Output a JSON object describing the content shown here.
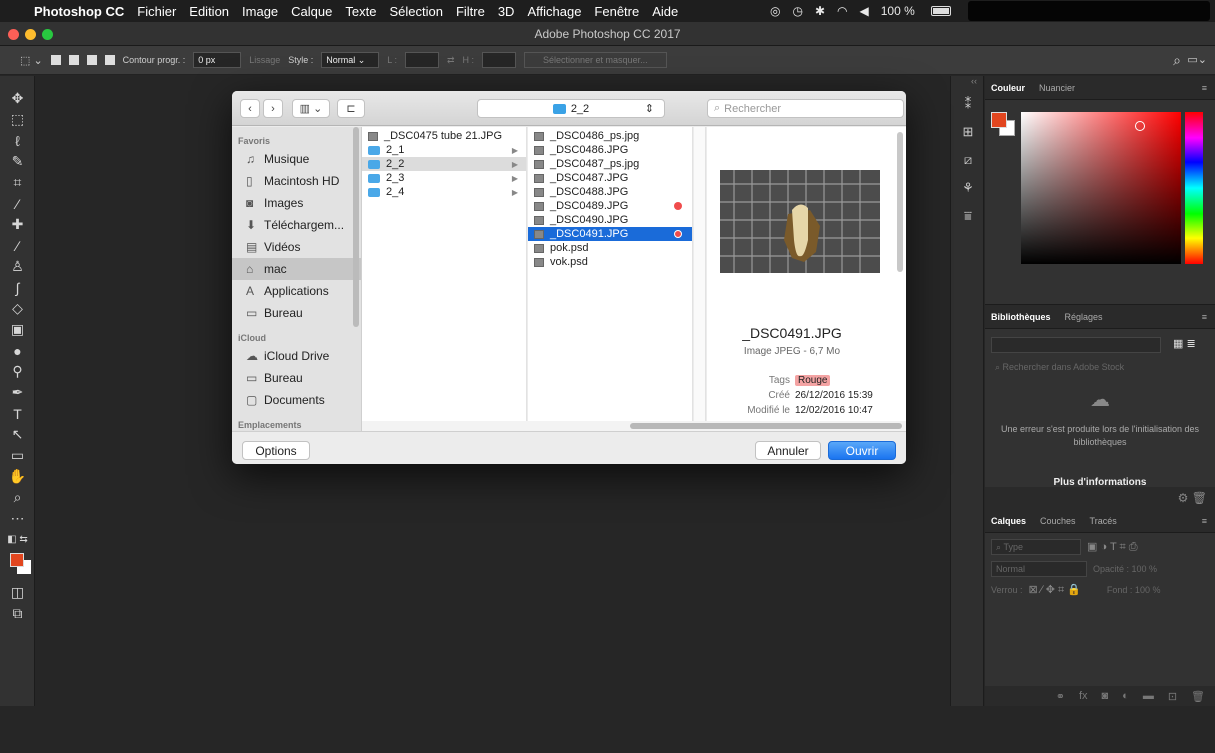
{
  "menubar": {
    "items": [
      "Photoshop CC",
      "Fichier",
      "Edition",
      "Image",
      "Calque",
      "Texte",
      "Sélection",
      "Filtre",
      "3D",
      "Affichage",
      "Fenêtre",
      "Aide"
    ],
    "battery": "100 %"
  },
  "window": {
    "title": "Adobe Photoshop CC 2017"
  },
  "options": {
    "contour_label": "Contour progr. :",
    "contour_value": "0 px",
    "lissage": "Lissage",
    "style_label": "Style :",
    "style_value": "Normal",
    "l_label": "L :",
    "h_label": "H :",
    "select_mask": "Sélectionner et masquer..."
  },
  "dialog": {
    "path": "2_2",
    "search_placeholder": "Rechercher",
    "sidebar": [
      {
        "type": "head",
        "label": "Favoris"
      },
      {
        "type": "item",
        "label": "Musique",
        "icon": "music-icon"
      },
      {
        "type": "item",
        "label": "Macintosh HD",
        "icon": "disk-icon"
      },
      {
        "type": "item",
        "label": "Images",
        "icon": "camera-icon"
      },
      {
        "type": "item",
        "label": "Téléchargem...",
        "icon": "download-icon"
      },
      {
        "type": "item",
        "label": "Vidéos",
        "icon": "film-icon"
      },
      {
        "type": "item",
        "label": "mac",
        "icon": "home-icon",
        "selected": true
      },
      {
        "type": "item",
        "label": "Applications",
        "icon": "apps-icon"
      },
      {
        "type": "item",
        "label": "Bureau",
        "icon": "desktop-icon"
      },
      {
        "type": "head",
        "label": "iCloud"
      },
      {
        "type": "item",
        "label": "iCloud Drive",
        "icon": "cloud-icon"
      },
      {
        "type": "item",
        "label": "Bureau",
        "icon": "desktop-icon"
      },
      {
        "type": "item",
        "label": "Documents",
        "icon": "documents-icon"
      },
      {
        "type": "head",
        "label": "Emplacements"
      }
    ],
    "col1": [
      {
        "label": "_DSC0475 tube 21.JPG",
        "kind": "file"
      },
      {
        "label": "2_1",
        "kind": "folder",
        "arrow": true
      },
      {
        "label": "2_2",
        "kind": "folder",
        "arrow": true,
        "state": "gray"
      },
      {
        "label": "2_3",
        "kind": "folder",
        "arrow": true
      },
      {
        "label": "2_4",
        "kind": "folder",
        "arrow": true
      }
    ],
    "col2": [
      {
        "label": "_DSC0486_ps.jpg",
        "kind": "file"
      },
      {
        "label": "_DSC0486.JPG",
        "kind": "file"
      },
      {
        "label": "_DSC0487_ps.jpg",
        "kind": "file"
      },
      {
        "label": "_DSC0487.JPG",
        "kind": "file"
      },
      {
        "label": "_DSC0488.JPG",
        "kind": "file"
      },
      {
        "label": "_DSC0489.JPG",
        "kind": "file",
        "tag": true
      },
      {
        "label": "_DSC0490.JPG",
        "kind": "file"
      },
      {
        "label": "_DSC0491.JPG",
        "kind": "file",
        "tag": true,
        "state": "sel"
      },
      {
        "label": "pok.psd",
        "kind": "file"
      },
      {
        "label": "vok.psd",
        "kind": "file"
      }
    ],
    "preview": {
      "name": "_DSC0491.JPG",
      "kind": "Image JPEG - 6,7 Mo",
      "tags_label": "Tags",
      "tags_value": "Rouge",
      "created_label": "Créé",
      "created_value": "26/12/2016 15:39",
      "modified_label": "Modifié le",
      "modified_value": "12/02/2016 10:47"
    },
    "options_btn": "Options",
    "cancel_btn": "Annuler",
    "open_btn": "Ouvrir"
  },
  "panels": {
    "color_tabs": [
      "Couleur",
      "Nuancier"
    ],
    "lib_tabs": [
      "Bibliothèques",
      "Réglages"
    ],
    "lib_search": "Rechercher dans Adobe Stock",
    "lib_error": "Une erreur s'est produite lors de l'initialisation des bibliothèques",
    "lib_more": "Plus d'informations",
    "layer_tabs": [
      "Calques",
      "Couches",
      "Tracés"
    ],
    "layer_type": "Type",
    "blend": "Normal",
    "opacity": "Opacité : 100 %",
    "lock": "Verrou :",
    "fill": "Fond : 100 %"
  },
  "colors": {
    "accent": "#1a6bd9",
    "fg": "#e2461f",
    "tag": "#f04c4c"
  }
}
